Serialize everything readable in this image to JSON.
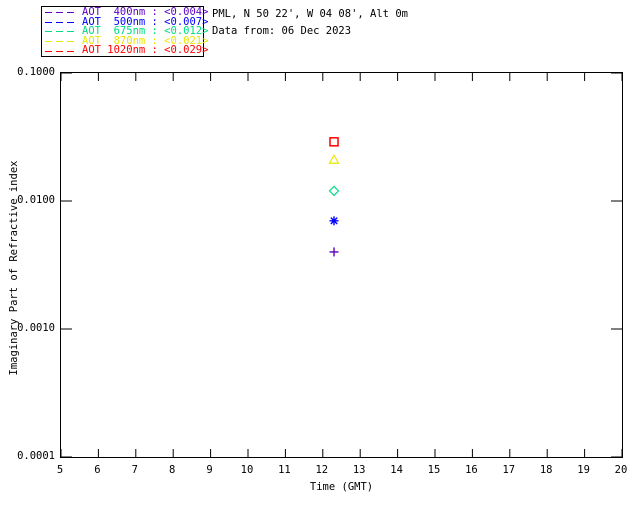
{
  "header": {
    "site_line": "PML, N 50 22', W 04 08', Alt 0m",
    "date_line": "Data from: 06 Dec 2023"
  },
  "legend": {
    "items": [
      {
        "label": "AOT  400nm : <0.004>",
        "color": "#5C00C4",
        "marker": "plus"
      },
      {
        "label": "AOT  500nm : <0.007>",
        "color": "#0000FF",
        "marker": "asterisk"
      },
      {
        "label": "AOT  675nm : <0.012>",
        "color": "#00DC82",
        "marker": "diamond"
      },
      {
        "label": "AOT  870nm : <0.021>",
        "color": "#E8E800",
        "marker": "triangle"
      },
      {
        "label": "AOT 1020nm : <0.029>",
        "color": "#FF0000",
        "marker": "square"
      }
    ]
  },
  "chart_data": {
    "type": "scatter",
    "title": "",
    "xlabel": "Time (GMT)",
    "ylabel": "Imaginary Part of Refractive index",
    "xlim": [
      5,
      20
    ],
    "ylim": [
      0.0001,
      0.1
    ],
    "yscale": "log",
    "grid": false,
    "legend_position": "top-left-outside",
    "x_ticks": [
      5,
      6,
      7,
      8,
      9,
      10,
      11,
      12,
      13,
      14,
      15,
      16,
      17,
      18,
      19,
      20
    ],
    "y_ticks": [
      {
        "value": 0.1,
        "label": "0.1000"
      },
      {
        "value": 0.01,
        "label": "0.0100"
      },
      {
        "value": 0.001,
        "label": "0.0010"
      },
      {
        "value": 0.0001,
        "label": "0.0001"
      }
    ],
    "series": [
      {
        "name": "AOT 400nm",
        "wavelength_nm": 400,
        "marker": "plus",
        "color": "#5C00C4",
        "x": [
          12.3
        ],
        "y": [
          0.004
        ]
      },
      {
        "name": "AOT 500nm",
        "wavelength_nm": 500,
        "marker": "asterisk",
        "color": "#0000FF",
        "x": [
          12.3
        ],
        "y": [
          0.007
        ]
      },
      {
        "name": "AOT 675nm",
        "wavelength_nm": 675,
        "marker": "diamond",
        "color": "#00DC82",
        "x": [
          12.3
        ],
        "y": [
          0.012
        ]
      },
      {
        "name": "AOT 870nm",
        "wavelength_nm": 870,
        "marker": "triangle",
        "color": "#E8E800",
        "x": [
          12.3
        ],
        "y": [
          0.021
        ]
      },
      {
        "name": "AOT 1020nm",
        "wavelength_nm": 1020,
        "marker": "square",
        "color": "#FF0000",
        "x": [
          12.3
        ],
        "y": [
          0.029
        ]
      }
    ]
  }
}
